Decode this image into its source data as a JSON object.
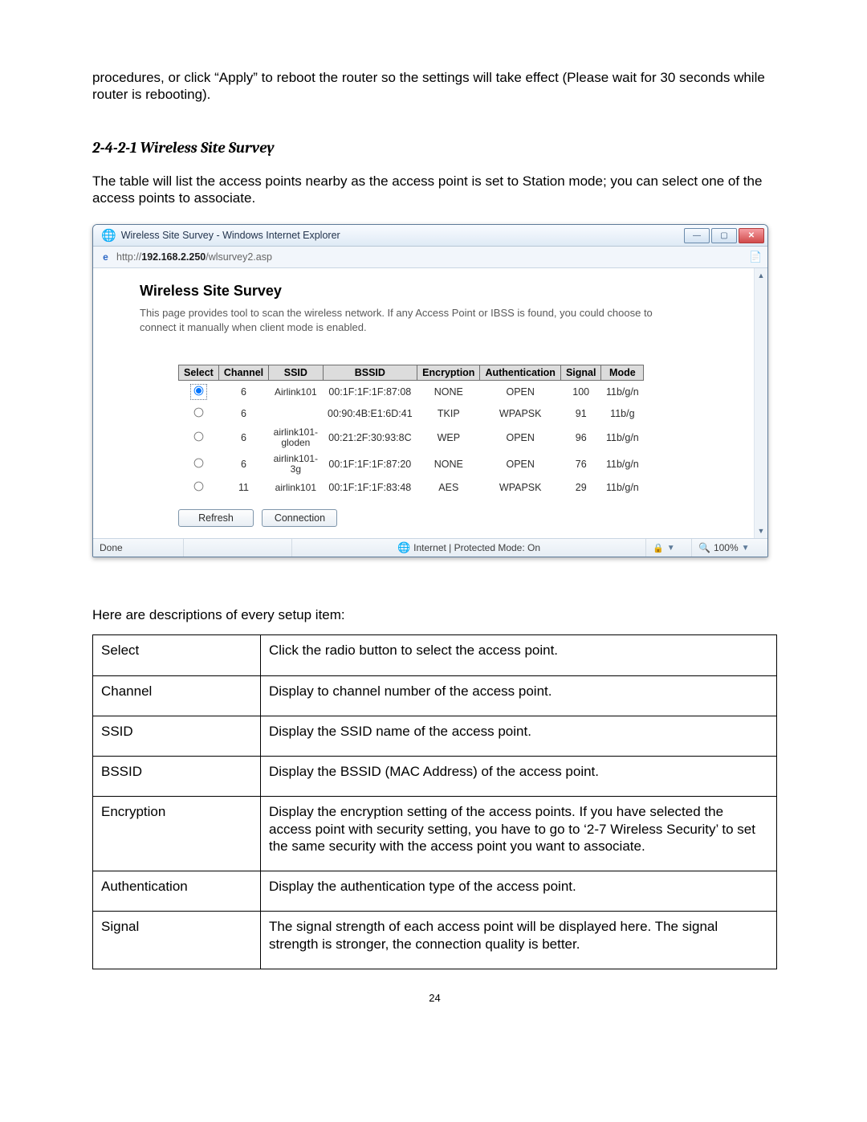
{
  "intro": "procedures, or click “Apply” to reboot the router so the settings will take effect (Please wait for 30 seconds while router is rebooting).",
  "heading": "2-4-2-1 Wireless Site Survey",
  "body": "The table will list the access points nearby as the access point is set to Station mode; you can select one of the access points to associate.",
  "window": {
    "title": "Wireless Site Survey - Windows Internet Explorer",
    "url_prefix": "http://",
    "url_host": "192.168.2.250",
    "url_path": "/wlsurvey2.asp",
    "page_heading": "Wireless Site Survey",
    "page_desc": "This page provides tool to scan the wireless network. If any Access Point or IBSS is found, you could choose to connect it manually when client mode is enabled.",
    "columns": [
      "Select",
      "Channel",
      "SSID",
      "BSSID",
      "Encryption",
      "Authentication",
      "Signal",
      "Mode"
    ],
    "rows": [
      {
        "selected": true,
        "channel": "6",
        "ssid": "Airlink101",
        "bssid": "00:1F:1F:1F:87:08",
        "enc": "NONE",
        "auth": "OPEN",
        "signal": "100",
        "mode": "11b/g/n"
      },
      {
        "selected": false,
        "channel": "6",
        "ssid": "",
        "bssid": "00:90:4B:E1:6D:41",
        "enc": "TKIP",
        "auth": "WPAPSK",
        "signal": "91",
        "mode": "11b/g"
      },
      {
        "selected": false,
        "channel": "6",
        "ssid": "airlink101-\ngloden",
        "bssid": "00:21:2F:30:93:8C",
        "enc": "WEP",
        "auth": "OPEN",
        "signal": "96",
        "mode": "11b/g/n"
      },
      {
        "selected": false,
        "channel": "6",
        "ssid": "airlink101-\n3g",
        "bssid": "00:1F:1F:1F:87:20",
        "enc": "NONE",
        "auth": "OPEN",
        "signal": "76",
        "mode": "11b/g/n"
      },
      {
        "selected": false,
        "channel": "11",
        "ssid": "airlink101",
        "bssid": "00:1F:1F:1F:83:48",
        "enc": "AES",
        "auth": "WPAPSK",
        "signal": "29",
        "mode": "11b/g/n"
      }
    ],
    "buttons": {
      "refresh": "Refresh",
      "connection": "Connection"
    },
    "status": {
      "done": "Done",
      "zone": "Internet | Protected Mode: On",
      "zoom": "100%"
    }
  },
  "lead_in": "Here are descriptions of every setup item:",
  "defs": [
    {
      "term": "Select",
      "desc": "Click the radio button to select the access point."
    },
    {
      "term": "Channel",
      "desc": "Display to channel number of the access point."
    },
    {
      "term": "SSID",
      "desc": "Display the SSID name of the access point."
    },
    {
      "term": "BSSID",
      "desc": "Display the BSSID (MAC Address) of the access point."
    },
    {
      "term": "Encryption",
      "desc": "Display the encryption setting of the access points. If you have selected the access point with security setting, you have to go to ‘2-7 Wireless Security’ to set the same security with the access point you want to associate."
    },
    {
      "term": "Authentication",
      "desc": "Display the authentication type of the access point."
    },
    {
      "term": "Signal",
      "desc": "The signal strength of each access point will be displayed here. The signal strength is stronger, the connection quality is better."
    }
  ],
  "page_number": "24"
}
